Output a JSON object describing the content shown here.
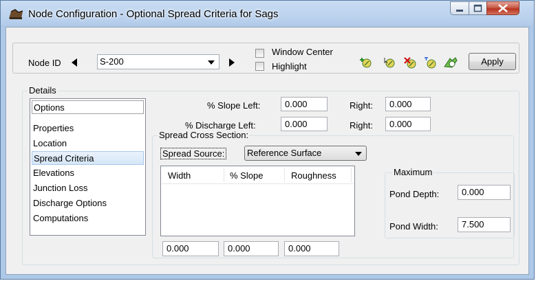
{
  "window": {
    "title": "Node Configuration - Optional Spread Criteria for Sags",
    "minimize_glyph": "▁",
    "maximize_glyph": "□",
    "close_glyph": "✕"
  },
  "toolbar": {
    "node_id_label": "Node ID",
    "node_id_value": "S-200",
    "window_center_label": "Window Center",
    "highlight_label": "Highlight",
    "window_center_checked": false,
    "highlight_checked": false,
    "apply_label": "Apply",
    "icons": [
      "add-node-icon",
      "select-node-icon",
      "delete-node-icon",
      "edit-node-icon",
      "locate-node-icon"
    ]
  },
  "details": {
    "group_label": "Details",
    "items": [
      {
        "label": "Options"
      },
      {
        "label": "Properties"
      },
      {
        "label": "Location"
      },
      {
        "label": "Spread Criteria"
      },
      {
        "label": "Elevations"
      },
      {
        "label": "Junction Loss"
      },
      {
        "label": "Discharge Options"
      },
      {
        "label": "Computations"
      }
    ],
    "selected": "Spread Criteria"
  },
  "slope": {
    "left_label": "% Slope Left:",
    "left_value": "0.000",
    "right_label": "Right:",
    "right_value": "0.000"
  },
  "discharge": {
    "left_label": "% Discharge Left:",
    "left_value": "0.000",
    "right_label": "Right:",
    "right_value": "0.000"
  },
  "spread_section": {
    "group_label": "Spread Cross Section:",
    "source_label": "Spread Source:",
    "source_value": "Reference Surface",
    "columns": [
      "Width",
      "% Slope",
      "Roughness"
    ],
    "rows": [],
    "inputs": [
      "0.000",
      "0.000",
      "0.000"
    ]
  },
  "maximum": {
    "group_label": "Maximum",
    "pond_depth_label": "Pond Depth:",
    "pond_depth_value": "0.000",
    "pond_width_label": "Pond Width:",
    "pond_width_value": "7.500"
  }
}
